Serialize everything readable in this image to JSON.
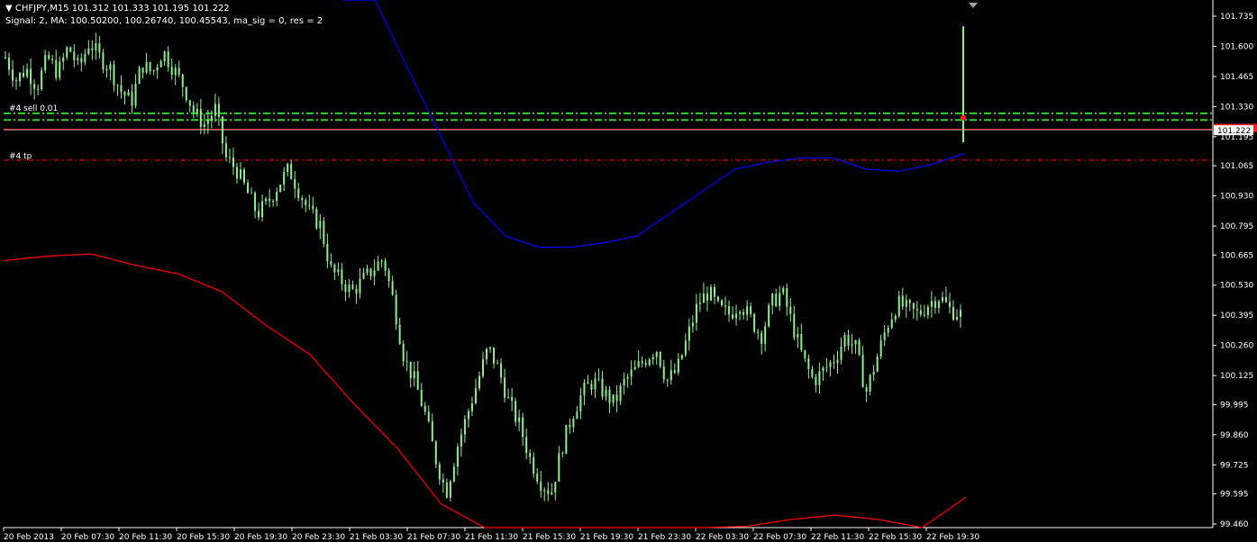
{
  "header": {
    "symbol_line": "CHFJPY,M15  101.312 101.333 101.195 101.222",
    "indicator_line": "Signal: 2, MA: 100.50200, 100.26740, 100.45543, ma_sig = 0, res = 2"
  },
  "trade_labels": {
    "sell": "#4 sell 0.01",
    "tp": "#4 tp"
  },
  "current_price": "101.222",
  "colors": {
    "background": "#000000",
    "candle": "#90ee90",
    "ma_blue": "#0000ff",
    "ma_red": "#ff0000",
    "sell_line": "#32cd32",
    "tp_line": "#ff0000",
    "price_line": "#c0c0c0",
    "axis": "#ffffff"
  },
  "chart_data": {
    "type": "candlestick",
    "symbol": "CHFJPY",
    "timeframe": "M15",
    "ylim": [
      99.4,
      101.8
    ],
    "y_ticks": [
      "101.735",
      "101.600",
      "101.465",
      "101.330",
      "101.195",
      "101.065",
      "100.930",
      "100.795",
      "100.665",
      "100.530",
      "100.395",
      "100.260",
      "100.125",
      "99.995",
      "99.860",
      "99.725",
      "99.595",
      "99.460"
    ],
    "x_ticks": [
      "20 Feb 2013",
      "20 Feb 07:30",
      "20 Feb 11:30",
      "20 Feb 15:30",
      "20 Feb 19:30",
      "20 Feb 23:30",
      "21 Feb 03:30",
      "21 Feb 07:30",
      "21 Feb 11:30",
      "21 Feb 15:30",
      "21 Feb 19:30",
      "21 Feb 23:30",
      "22 Feb 03:30",
      "22 Feb 07:30",
      "22 Feb 11:30",
      "22 Feb 15:30",
      "22 Feb 19:30"
    ],
    "series": [
      {
        "name": "price_path",
        "values": [
          101.55,
          101.45,
          101.5,
          101.42,
          101.55,
          101.48,
          101.6,
          101.5,
          101.62,
          101.55,
          101.5,
          101.4,
          101.35,
          101.52,
          101.48,
          101.58,
          101.5,
          101.42,
          101.3,
          101.25,
          101.32,
          101.1,
          101.05,
          100.95,
          100.85,
          100.9,
          100.98,
          101.05,
          100.95,
          100.85,
          100.8,
          100.6,
          100.55,
          100.5,
          100.55,
          100.6,
          100.65,
          100.45,
          100.2,
          100.1,
          99.95,
          99.75,
          99.6,
          99.8,
          99.95,
          100.1,
          100.25,
          100.15,
          100.0,
          99.9,
          99.75,
          99.65,
          99.6,
          99.8,
          99.95,
          100.05,
          100.1,
          100.05,
          100.0,
          100.1,
          100.15,
          100.2,
          100.25,
          100.1,
          100.15,
          100.3,
          100.45,
          100.5,
          100.42,
          100.4,
          100.45,
          100.38,
          100.3,
          100.45,
          100.5,
          100.35,
          100.2,
          100.1,
          100.15,
          100.2,
          100.3,
          100.25,
          100.05,
          100.2,
          100.35,
          100.45,
          100.42,
          100.4,
          100.45,
          100.48,
          100.42,
          100.4,
          101.222
        ]
      },
      {
        "name": "ma_blue",
        "values": [
          102.3,
          101.9,
          101.5,
          101.2,
          100.9,
          100.75,
          100.7,
          100.7,
          100.72,
          100.75,
          100.85,
          100.95,
          101.05,
          101.08,
          101.1,
          101.1,
          101.05,
          101.04,
          101.07,
          101.12
        ]
      },
      {
        "name": "ma_red",
        "values": [
          100.64,
          100.66,
          100.67,
          100.62,
          100.58,
          100.5,
          100.35,
          100.22,
          100.0,
          99.8,
          99.55,
          99.3,
          99.1,
          99.0,
          99.0,
          99.0,
          99.3,
          99.45,
          99.48,
          99.5,
          99.48,
          99.44,
          99.58
        ]
      }
    ],
    "trade_lines": {
      "sell_price": 101.3,
      "sell_price_2": 101.27,
      "tp_price": 101.09,
      "current_price": 101.222,
      "bid_price": 101.2
    },
    "grid": false,
    "legend": "none"
  }
}
